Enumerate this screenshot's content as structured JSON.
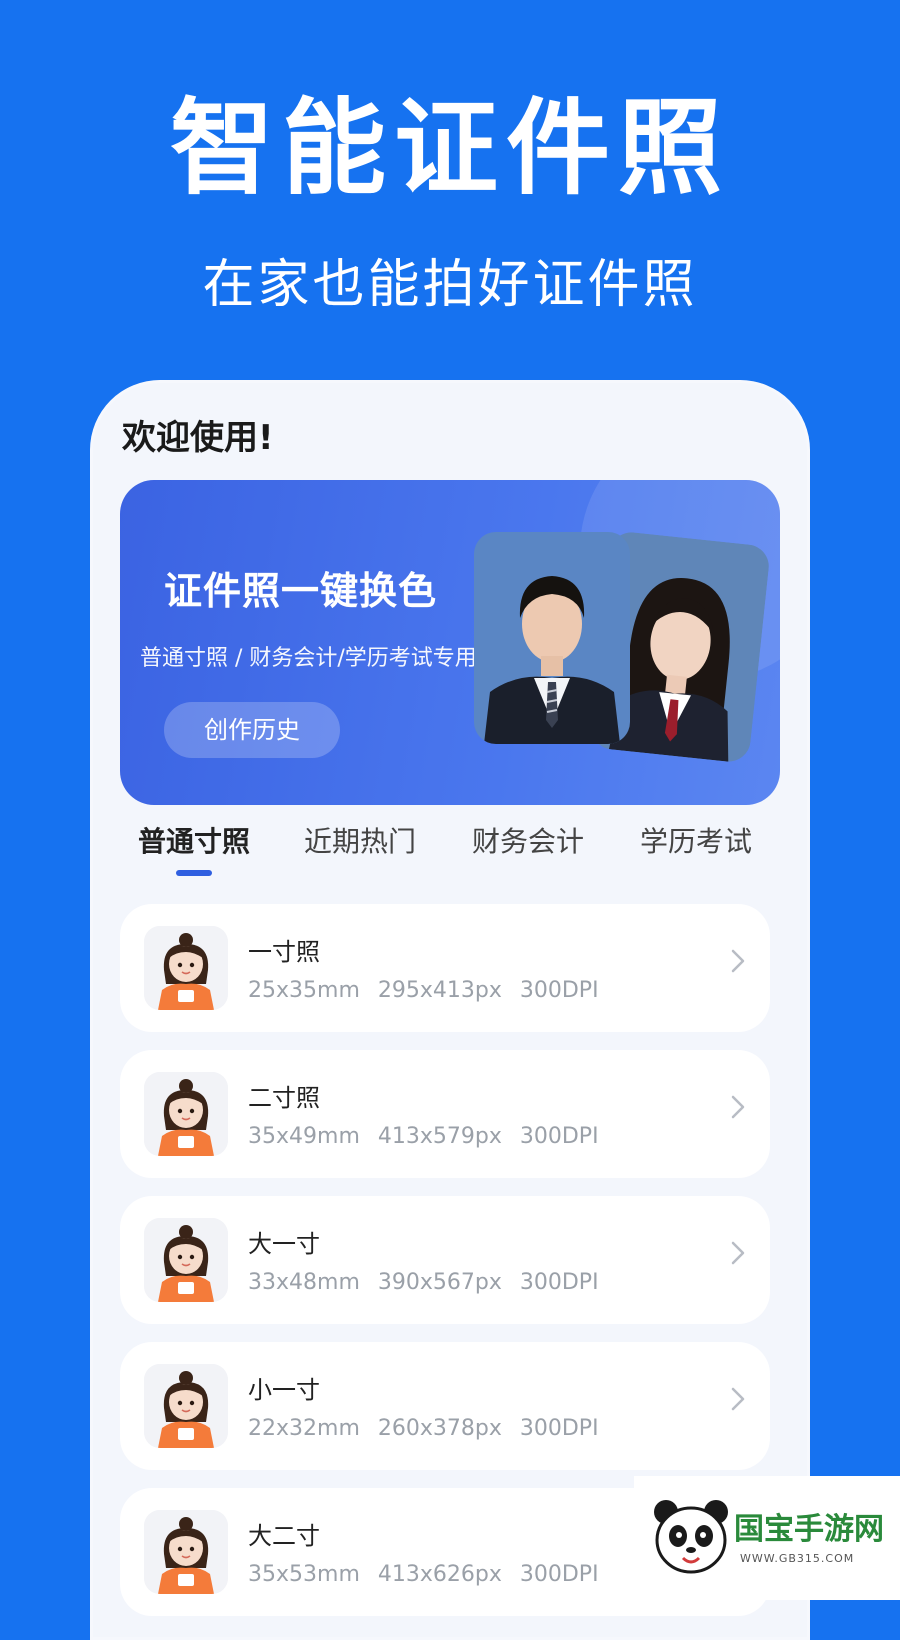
{
  "promo": {
    "headline": "智能证件照",
    "subline": "在家也能拍好证件照"
  },
  "app": {
    "welcome": "欢迎使用!",
    "banner": {
      "title": "证件照一键换色",
      "description": "普通寸照 / 财务会计/学历考试专用",
      "history_button": "创作历史"
    },
    "tabs": [
      {
        "label": "普通寸照",
        "active": true
      },
      {
        "label": "近期热门",
        "active": false
      },
      {
        "label": "财务会计",
        "active": false
      },
      {
        "label": "学历考试",
        "active": false
      }
    ],
    "sizes": [
      {
        "name": "一寸照",
        "mm": "25x35mm",
        "px": "295x413px",
        "dpi": "300DPI"
      },
      {
        "name": "二寸照",
        "mm": "35x49mm",
        "px": "413x579px",
        "dpi": "300DPI"
      },
      {
        "name": "大一寸",
        "mm": "33x48mm",
        "px": "390x567px",
        "dpi": "300DPI"
      },
      {
        "name": "小一寸",
        "mm": "22x32mm",
        "px": "260x378px",
        "dpi": "300DPI"
      },
      {
        "name": "大二寸",
        "mm": "35x53mm",
        "px": "413x626px",
        "dpi": "300DPI"
      }
    ]
  },
  "watermark": {
    "name": "国宝手游网",
    "url": "WWW.GB315.COM"
  },
  "colors": {
    "background": "#1672F0",
    "banner": "#4a77ee",
    "accent": "#2f5fe0"
  }
}
